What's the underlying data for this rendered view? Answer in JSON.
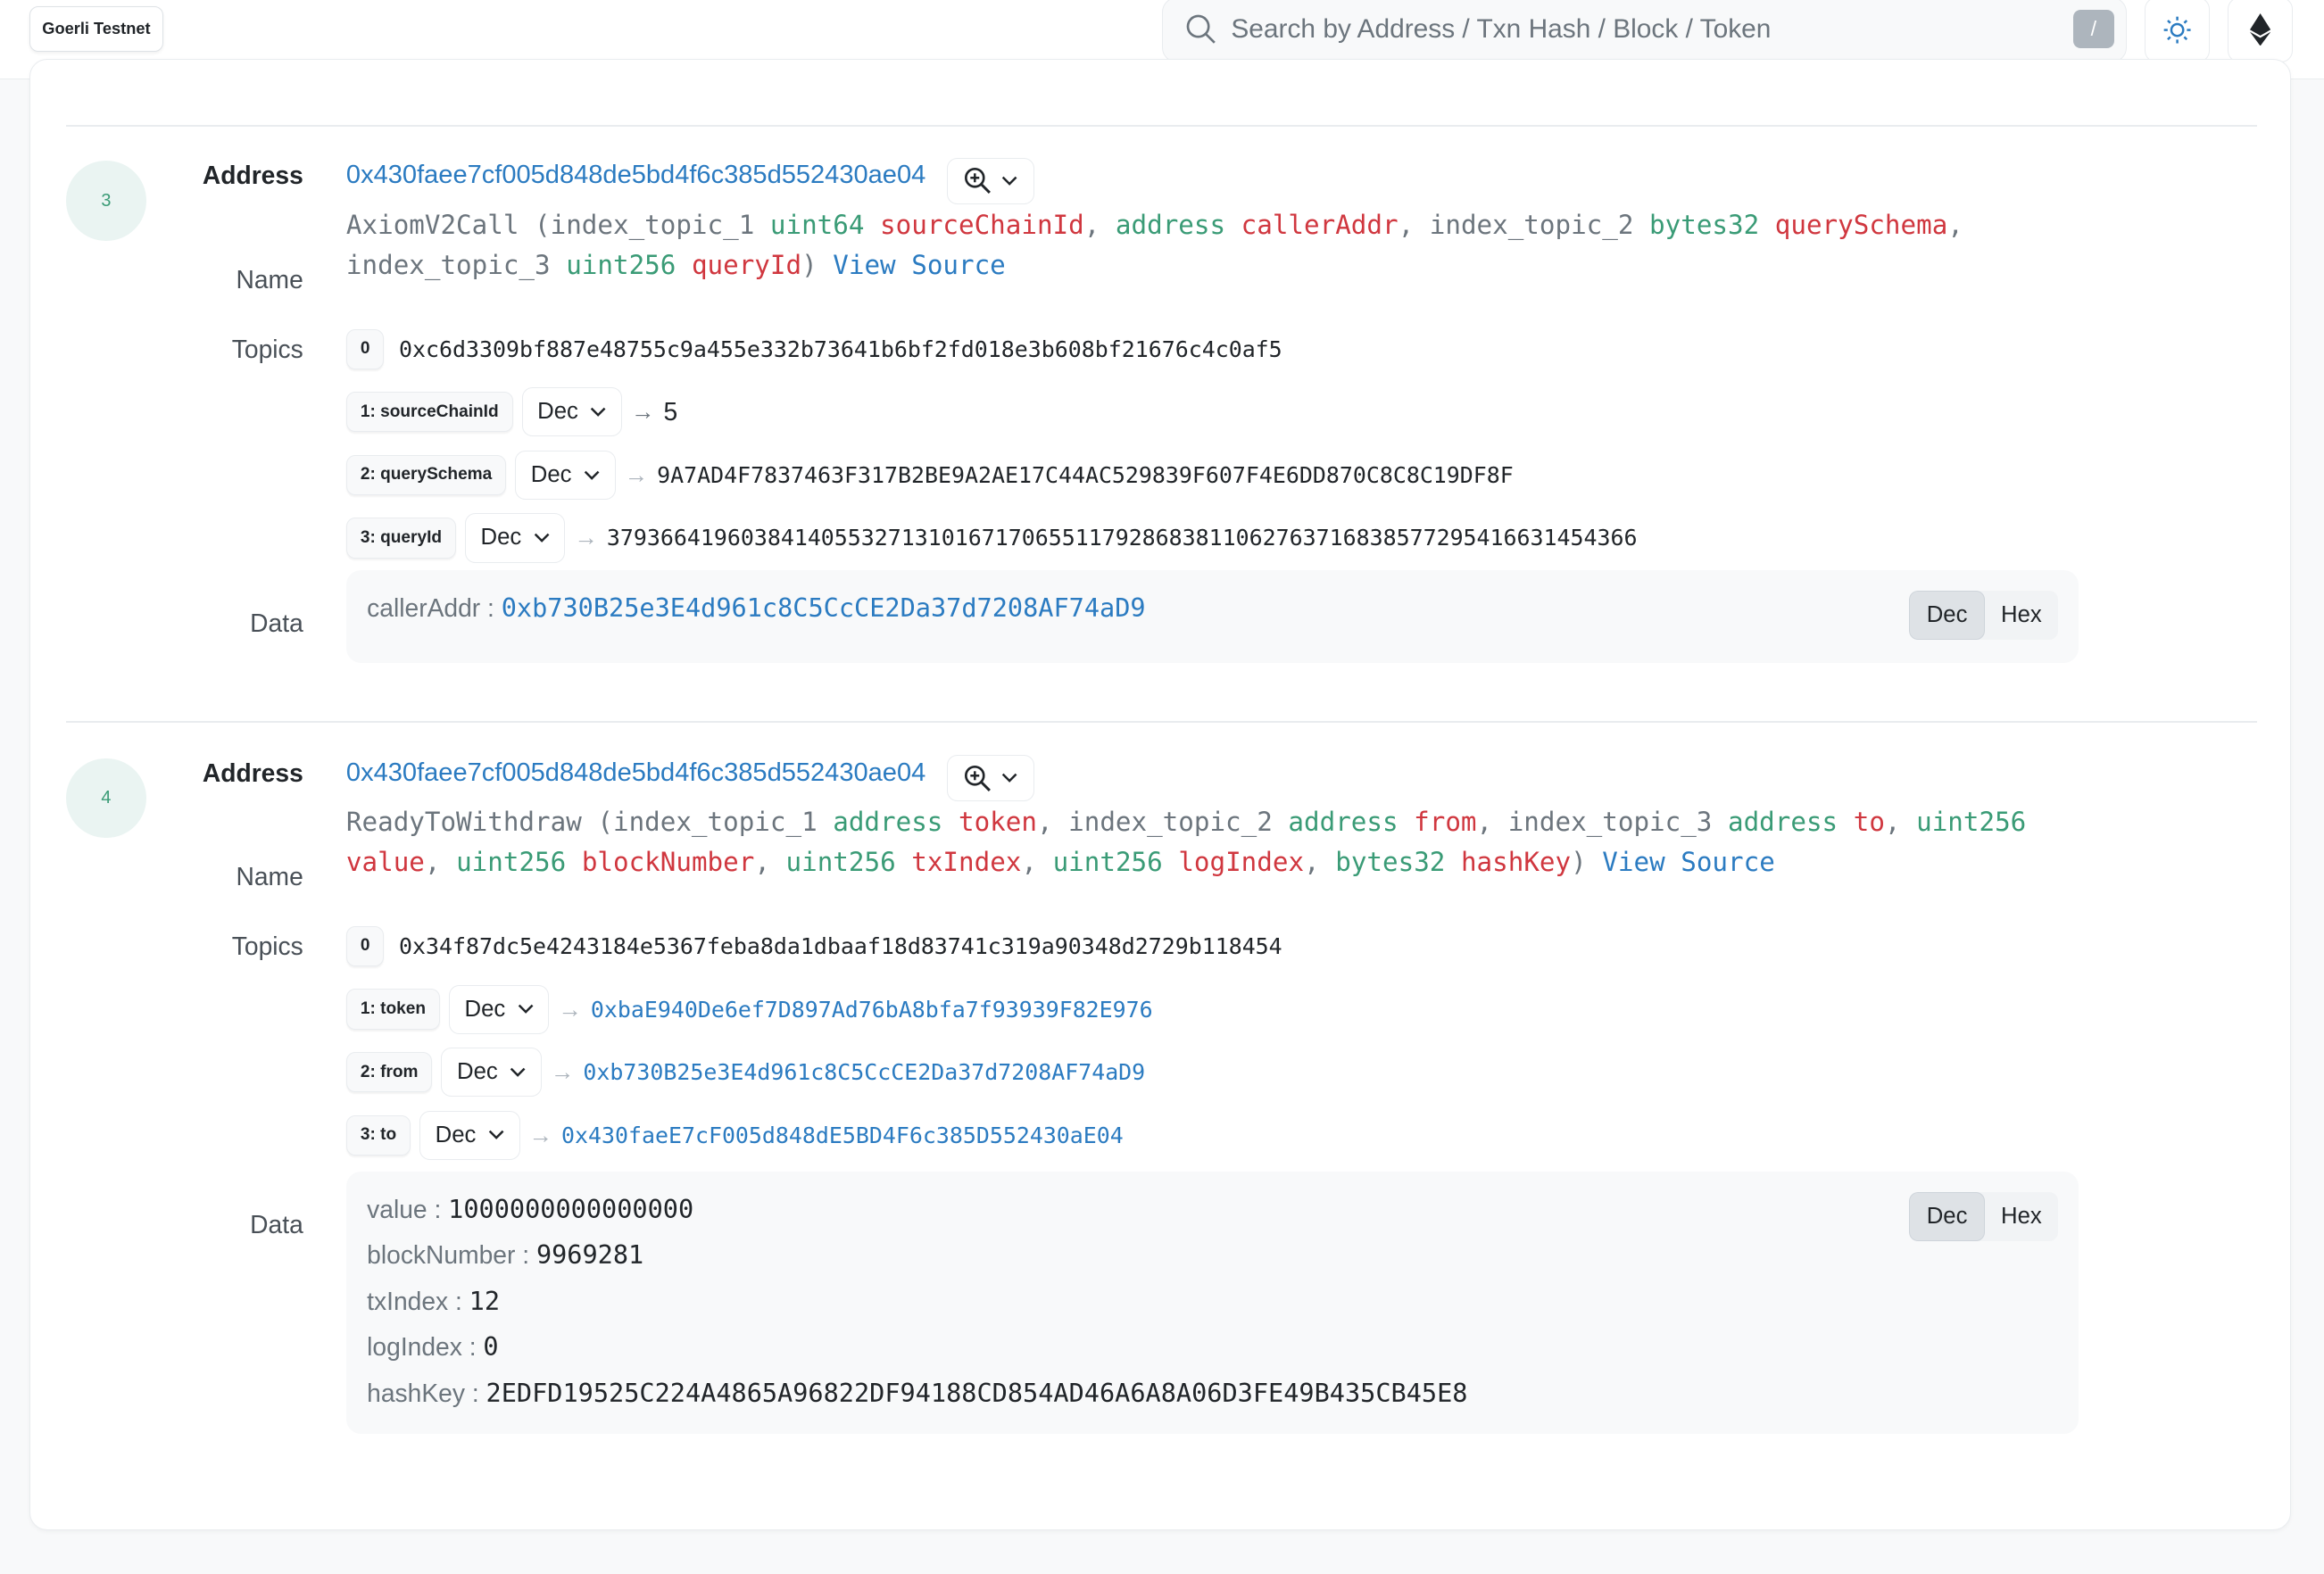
{
  "header": {
    "network_badge": "Goerli Testnet",
    "search_placeholder": "Search by Address / Txn Hash / Block / Token",
    "search_shortcut": "/",
    "theme_icon": "sun-icon",
    "network_icon": "ethereum-icon"
  },
  "labels": {
    "address": "Address",
    "name": "Name",
    "topics": "Topics",
    "data": "Data"
  },
  "colors": {
    "link": "#2b7bc1",
    "type": "#3a9b76",
    "param_name": "#d0373f",
    "muted": "#6c757d"
  },
  "events": [
    {
      "index": "3",
      "address": "0x430faee7cf005d848de5bd4f6c385d552430ae04",
      "name_segments": [
        {
          "text": "AxiomV2Call (index_topic_1 ",
          "kind": "p"
        },
        {
          "text": "uint64",
          "kind": "t"
        },
        {
          "text": " ",
          "kind": "p"
        },
        {
          "text": "sourceChainId",
          "kind": "n"
        },
        {
          "text": ", ",
          "kind": "p"
        },
        {
          "text": "address",
          "kind": "t"
        },
        {
          "text": " ",
          "kind": "p"
        },
        {
          "text": "callerAddr",
          "kind": "n"
        },
        {
          "text": ", index_topic_2 ",
          "kind": "p"
        },
        {
          "text": "bytes32",
          "kind": "t"
        },
        {
          "text": " ",
          "kind": "p"
        },
        {
          "text": "querySchema",
          "kind": "n"
        },
        {
          "text": ", index_topic_3 ",
          "kind": "p"
        },
        {
          "text": "uint256",
          "kind": "t"
        },
        {
          "text": " ",
          "kind": "p"
        },
        {
          "text": "queryId",
          "kind": "n"
        },
        {
          "text": ") ",
          "kind": "p"
        }
      ],
      "view_source": "View Source",
      "topics": [
        {
          "label": "0",
          "value": "0xc6d3309bf887e48755c9a455e332b73641b6bf2fd018e3b608bf21676c4c0af5"
        },
        {
          "label": "1: sourceChainId",
          "format": "Dec",
          "value": "5",
          "plain": true
        },
        {
          "label": "2: querySchema",
          "format": "Dec",
          "value": "9A7AD4F7837463F317B2BE9A2AE17C44AC529839F607F4E6DD870C8C8C19DF8F"
        },
        {
          "label": "3: queryId",
          "format": "Dec",
          "value": "37936641960384140553271310167170655117928683811062763716838577295416631454366"
        }
      ],
      "data": [
        {
          "key": "callerAddr",
          "value": "0xb730B25e3E4d961c8C5CcCE2Da37d7208AF74aD9",
          "link": true
        }
      ],
      "toggle": [
        "Dec",
        "Hex"
      ],
      "active_toggle": "Dec"
    },
    {
      "index": "4",
      "address": "0x430faee7cf005d848de5bd4f6c385d552430ae04",
      "name_segments": [
        {
          "text": "ReadyToWithdraw (index_topic_1 ",
          "kind": "p"
        },
        {
          "text": "address",
          "kind": "t"
        },
        {
          "text": " ",
          "kind": "p"
        },
        {
          "text": "token",
          "kind": "n"
        },
        {
          "text": ", index_topic_2 ",
          "kind": "p"
        },
        {
          "text": "address",
          "kind": "t"
        },
        {
          "text": " ",
          "kind": "p"
        },
        {
          "text": "from",
          "kind": "n"
        },
        {
          "text": ", index_topic_3 ",
          "kind": "p"
        },
        {
          "text": "address",
          "kind": "t"
        },
        {
          "text": " ",
          "kind": "p"
        },
        {
          "text": "to",
          "kind": "n"
        },
        {
          "text": ", ",
          "kind": "p"
        },
        {
          "text": "uint256",
          "kind": "t"
        },
        {
          "text": " ",
          "kind": "p"
        },
        {
          "text": "value",
          "kind": "n"
        },
        {
          "text": ", ",
          "kind": "p"
        },
        {
          "text": "uint256",
          "kind": "t"
        },
        {
          "text": " ",
          "kind": "p"
        },
        {
          "text": "blockNumber",
          "kind": "n"
        },
        {
          "text": ", ",
          "kind": "p"
        },
        {
          "text": "uint256",
          "kind": "t"
        },
        {
          "text": " ",
          "kind": "p"
        },
        {
          "text": "txIndex",
          "kind": "n"
        },
        {
          "text": ", ",
          "kind": "p"
        },
        {
          "text": "uint256",
          "kind": "t"
        },
        {
          "text": " ",
          "kind": "p"
        },
        {
          "text": "logIndex",
          "kind": "n"
        },
        {
          "text": ", ",
          "kind": "p"
        },
        {
          "text": "bytes32",
          "kind": "t"
        },
        {
          "text": " ",
          "kind": "p"
        },
        {
          "text": "hashKey",
          "kind": "n"
        },
        {
          "text": ") ",
          "kind": "p"
        }
      ],
      "view_source": "View Source",
      "topics": [
        {
          "label": "0",
          "value": "0x34f87dc5e4243184e5367feba8da1dbaaf18d83741c319a90348d2729b118454"
        },
        {
          "label": "1: token",
          "format": "Dec",
          "value": "0xbaE940De6ef7D897Ad76bA8bfa7f93939F82E976",
          "link": true
        },
        {
          "label": "2: from",
          "format": "Dec",
          "value": "0xb730B25e3E4d961c8C5CcCE2Da37d7208AF74aD9",
          "link": true
        },
        {
          "label": "3: to",
          "format": "Dec",
          "value": "0x430faeE7cF005d848dE5BD4F6c385D552430aE04",
          "link": true
        }
      ],
      "data": [
        {
          "key": "value",
          "value": "1000000000000000"
        },
        {
          "key": "blockNumber",
          "value": "9969281"
        },
        {
          "key": "txIndex",
          "value": "12"
        },
        {
          "key": "logIndex",
          "value": "0"
        },
        {
          "key": "hashKey",
          "value": "2EDFD19525C224A4865A96822DF94188CD854AD46A6A8A06D3FE49B435CB45E8"
        }
      ],
      "toggle": [
        "Dec",
        "Hex"
      ],
      "active_toggle": "Dec"
    }
  ]
}
